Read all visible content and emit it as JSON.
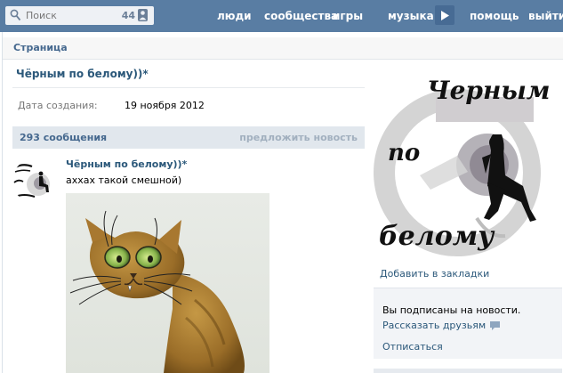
{
  "header": {
    "search": {
      "placeholder": "Поиск",
      "count": "44"
    },
    "nav": [
      "люди",
      "сообщества",
      "игры",
      "музыка",
      "помощь",
      "выйти"
    ]
  },
  "breadcrumb": "Страница",
  "page": {
    "title": "Чёрным по белому))*",
    "info": {
      "label": "Дата создания:",
      "value": "19 ноября 2012"
    }
  },
  "wall": {
    "count": "293 сообщения",
    "suggest": "предложить новость",
    "post": {
      "author": "Чёрным по белому))*",
      "text": "аххах такой смешной)"
    }
  },
  "sidebar": {
    "logo_text": [
      "Черным",
      "по",
      "белому"
    ],
    "bookmark": "Добавить в закладки",
    "subscription": {
      "status": "Вы подписаны на новости.",
      "tell_friends": "Рассказать друзьям",
      "unsubscribe": "Отписаться"
    }
  },
  "colors": {
    "header_bg": "#597da3",
    "link": "#2b587a",
    "wall_bar": "#e1e7ed"
  }
}
